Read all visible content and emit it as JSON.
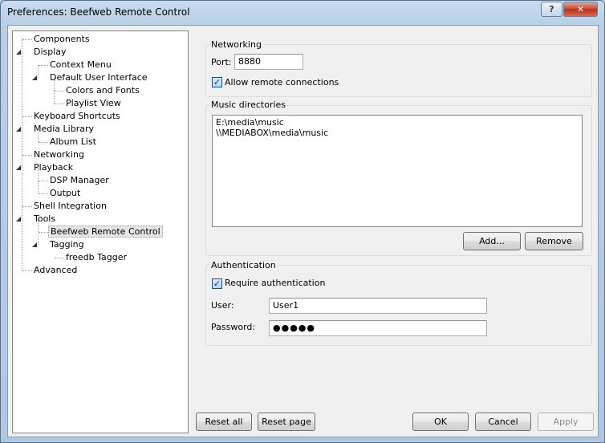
{
  "window": {
    "title": "Preferences: Beefweb Remote Control",
    "help_label": "?",
    "close_label": "✕"
  },
  "tree": {
    "items": [
      {
        "label": "Components"
      },
      {
        "label": "Display"
      },
      {
        "label": "Context Menu"
      },
      {
        "label": "Default User Interface"
      },
      {
        "label": "Colors and Fonts"
      },
      {
        "label": "Playlist View"
      },
      {
        "label": "Keyboard Shortcuts"
      },
      {
        "label": "Media Library"
      },
      {
        "label": "Album List"
      },
      {
        "label": "Networking"
      },
      {
        "label": "Playback"
      },
      {
        "label": "DSP Manager"
      },
      {
        "label": "Output"
      },
      {
        "label": "Shell Integration"
      },
      {
        "label": "Tools"
      },
      {
        "label": "Beefweb Remote Control"
      },
      {
        "label": "Tagging"
      },
      {
        "label": "freedb Tagger"
      },
      {
        "label": "Advanced"
      }
    ],
    "selected": "Beefweb Remote Control"
  },
  "networking": {
    "group_label": "Networking",
    "port_label": "Port:",
    "port_value": "8880",
    "allow_remote_label": "Allow remote connections",
    "allow_remote_checked": true
  },
  "music_dirs": {
    "group_label": "Music directories",
    "entries": [
      "E:\\media\\music",
      "\\\\MEDIABOX\\media\\music"
    ],
    "add_label": "Add...",
    "remove_label": "Remove"
  },
  "auth": {
    "group_label": "Authentication",
    "require_label": "Require authentication",
    "require_checked": true,
    "user_label": "User:",
    "user_value": "User1",
    "password_label": "Password:",
    "password_value": "●●●●●"
  },
  "footer": {
    "reset_all_label": "Reset all",
    "reset_page_label": "Reset page",
    "ok_label": "OK",
    "cancel_label": "Cancel",
    "apply_label": "Apply"
  }
}
